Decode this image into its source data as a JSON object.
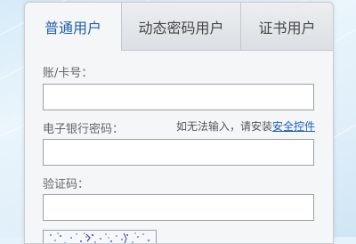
{
  "tabs": [
    {
      "label": "普通用户"
    },
    {
      "label": "动态密码用户"
    },
    {
      "label": "证书用户"
    }
  ],
  "form": {
    "account_label": "账/卡号：",
    "account_value": "",
    "password_label": "电子银行密码：",
    "password_value": "",
    "password_hint": "如无法输入，请安装",
    "password_hint_link": "安全控件",
    "captcha_label": "验证码：",
    "captcha_value": ""
  },
  "colors": {
    "active_tab_text": "#1f5fa8",
    "link": "#1a5fbd",
    "background": "#e6f2fb"
  }
}
